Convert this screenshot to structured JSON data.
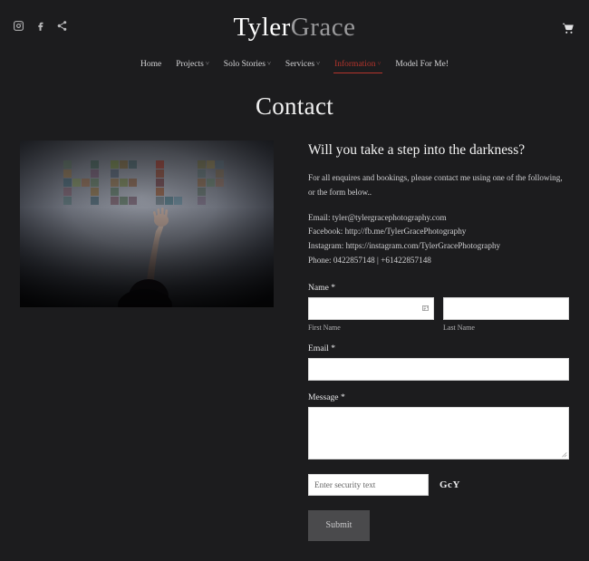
{
  "header": {
    "brand_first": "Tyler",
    "brand_second": "Grace",
    "social": [
      {
        "name": "instagram-icon",
        "label": "Instagram"
      },
      {
        "name": "facebook-icon",
        "label": "Facebook"
      },
      {
        "name": "share-icon",
        "label": "Share"
      }
    ],
    "cart_label": "Cart"
  },
  "nav": {
    "items": [
      {
        "label": "Home",
        "has_dropdown": false,
        "active": false
      },
      {
        "label": "Projects",
        "has_dropdown": true,
        "active": false
      },
      {
        "label": "Solo Stories",
        "has_dropdown": true,
        "active": false
      },
      {
        "label": "Services",
        "has_dropdown": true,
        "active": false
      },
      {
        "label": "Information",
        "has_dropdown": true,
        "active": true
      },
      {
        "label": "Model For Me!",
        "has_dropdown": false,
        "active": false
      }
    ],
    "caret_glyph": "˅",
    "active_color": "#b5342c"
  },
  "page": {
    "title": "Contact"
  },
  "photo": {
    "alt": "Dark photograph of the word HELP spelled out with small photographs on a wall, with a person's arm reaching up toward it",
    "word": "HELP"
  },
  "main": {
    "heading": "Will you take a step into the darkness?",
    "intro": "For all enquires and bookings, please contact me using one of the following, or the form below..",
    "contacts": [
      "Email: tyler@tylergracephotography.com",
      "Facebook: http://fb.me/TylerGracePhotography",
      "Instagram: https://instagram.com/TylerGracePhotography",
      "Phone: 0422857148  | +61422857148"
    ]
  },
  "form": {
    "name": {
      "label": "Name *",
      "first_value": "",
      "first_placeholder": "",
      "first_sub_label": "First Name",
      "last_value": "",
      "last_placeholder": "",
      "last_sub_label": "Last Name"
    },
    "email": {
      "label": "Email *",
      "value": "",
      "placeholder": ""
    },
    "message": {
      "label": "Message *",
      "value": "",
      "placeholder": ""
    },
    "security": {
      "placeholder": "Enter security text",
      "value": "",
      "captcha": "GcY"
    },
    "submit_label": "Submit"
  }
}
